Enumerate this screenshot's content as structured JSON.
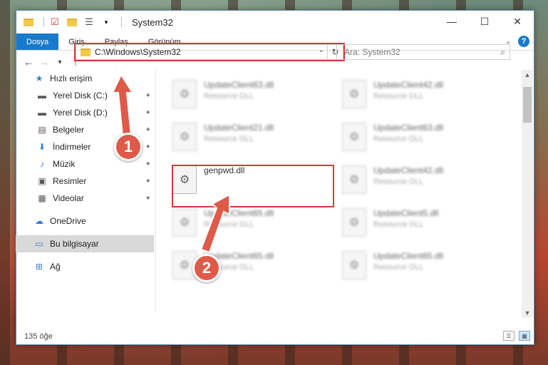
{
  "titlebar": {
    "title": "System32",
    "quick_access_icons": [
      "folder-icon",
      "properties-icon",
      "new-folder-icon",
      "view-icon"
    ],
    "controls": {
      "minimize": "—",
      "maximize": "☐",
      "close": "✕"
    }
  },
  "ribbon": {
    "tabs": [
      {
        "label": "Dosya",
        "active": true
      },
      {
        "label": "Giriş"
      },
      {
        "label": "Paylaş"
      },
      {
        "label": "Görünüm"
      }
    ],
    "help": "?"
  },
  "navigation": {
    "back": "←",
    "forward": "→",
    "recent": "▾",
    "up": "↑",
    "address": "C:\\Windows\\System32",
    "refresh": "↻",
    "search_placeholder": "Ara: System32",
    "search_icon": "search-icon"
  },
  "sidebar": {
    "items": [
      {
        "label": "Hızlı erişim",
        "icon": "star-icon",
        "glyph": "★",
        "pinned": false
      },
      {
        "label": "Yerel Disk (C:)",
        "icon": "disk-icon",
        "glyph": "▬",
        "pinned": true
      },
      {
        "label": "Yerel Disk (D:)",
        "icon": "disk-icon",
        "glyph": "▬",
        "pinned": true
      },
      {
        "label": "Belgeler",
        "icon": "document-icon",
        "glyph": "▤",
        "pinned": true
      },
      {
        "label": "İndirmeler",
        "icon": "download-icon",
        "glyph": "⬇",
        "pinned": true
      },
      {
        "label": "Müzik",
        "icon": "music-icon",
        "glyph": "♪",
        "pinned": true
      },
      {
        "label": "Resimler",
        "icon": "pictures-icon",
        "glyph": "▣",
        "pinned": true
      },
      {
        "label": "Videolar",
        "icon": "video-icon",
        "glyph": "▦",
        "pinned": true
      },
      {
        "label": "OneDrive",
        "icon": "cloud-icon",
        "glyph": "☁",
        "pinned": false
      },
      {
        "label": "Bu bilgisayar",
        "icon": "computer-icon",
        "glyph": "▭",
        "pinned": false,
        "selected": true
      },
      {
        "label": "Ağ",
        "icon": "network-icon",
        "glyph": "⊞",
        "pinned": false
      }
    ],
    "pin_glyph": "📌"
  },
  "files": [
    {
      "name": "UpdateClient63.dll",
      "type": "Resource DLL",
      "blurred": true
    },
    {
      "name": "UpdateClient42.dll",
      "type": "Resource DLL",
      "blurred": true
    },
    {
      "name": "UpdateClient21.dll",
      "type": "Resource DLL",
      "blurred": true
    },
    {
      "name": "UpdateClient63.dll",
      "type": "Resource DLL",
      "blurred": true
    },
    {
      "name": "genpwd.dll",
      "type": "",
      "blurred": false
    },
    {
      "name": "UpdateClient42.dll",
      "type": "Resource DLL",
      "blurred": true
    },
    {
      "name": "UpdateClient65.dll",
      "type": "Resource DLL",
      "blurred": true
    },
    {
      "name": "UpdateClient5.dll",
      "type": "Resource DLL",
      "blurred": true
    },
    {
      "name": "UpdateClient65.dll",
      "type": "Resource DLL",
      "blurred": true
    },
    {
      "name": "UpdateClient65.dll",
      "type": "Resource DLL",
      "blurred": true
    }
  ],
  "status": {
    "item_count": "135 öğe"
  },
  "annotations": {
    "marker_1": "1",
    "marker_2": "2"
  }
}
